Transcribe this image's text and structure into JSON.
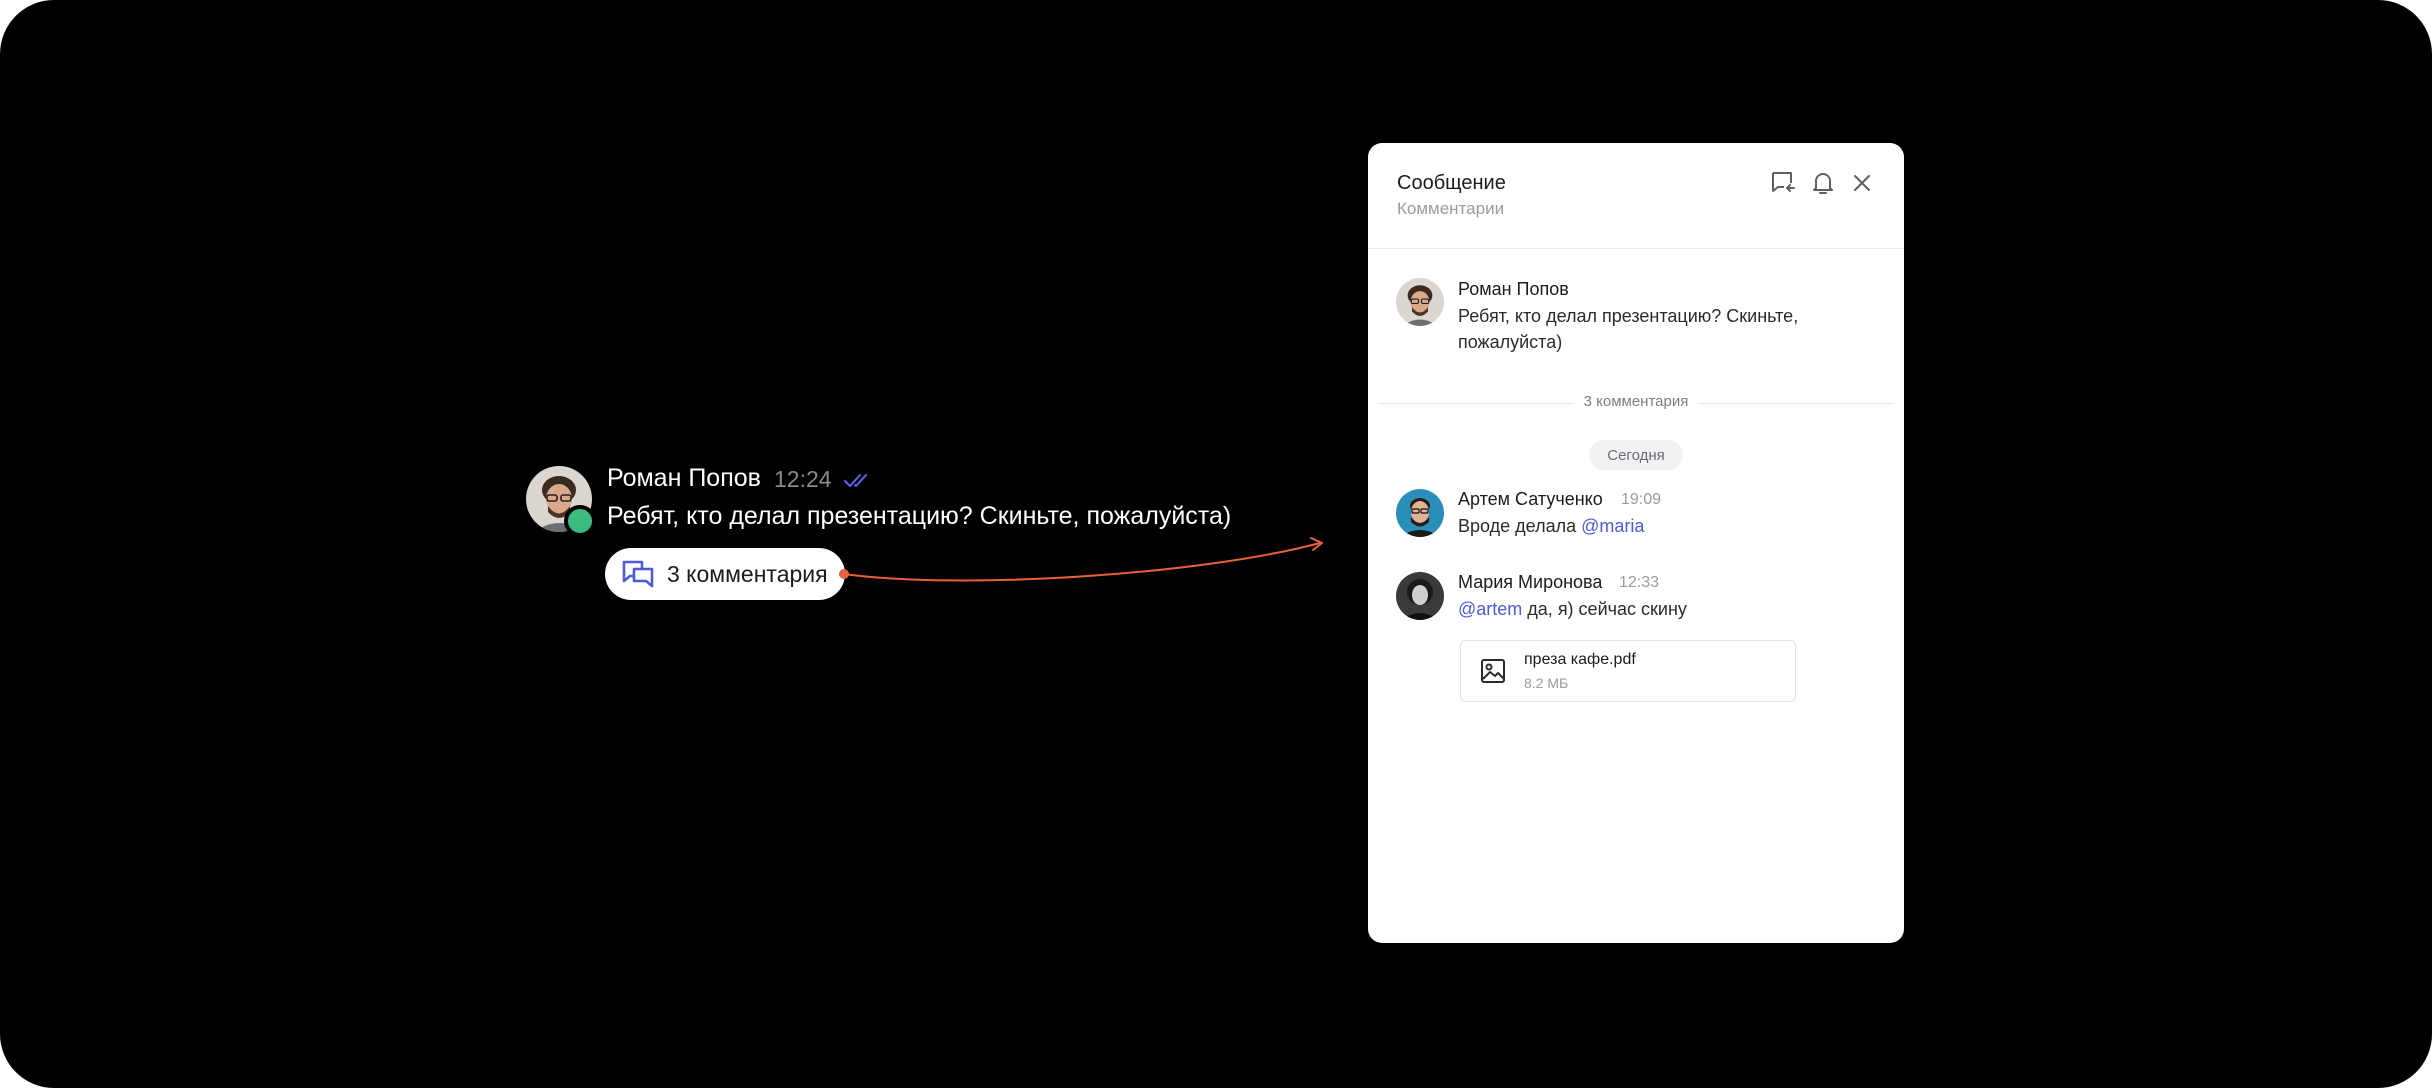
{
  "message": {
    "author": "Роман Попов",
    "time": "12:24",
    "text": "Ребят, кто делал презентацию? Скиньте, пожалуйста)",
    "comments_label": "3 комментария",
    "status": "online",
    "read_icon": "double-check-icon"
  },
  "panel": {
    "title": "Сообщение",
    "subtitle": "Комментарии",
    "header_icons": [
      "reply-icon",
      "bell-icon",
      "close-icon"
    ],
    "root": {
      "author": "Роман Попов",
      "text": "Ребят, кто делал презентацию? Скиньте, пожалуйста)"
    },
    "comments_count_label": "3 комментария",
    "day_label": "Сегодня",
    "comments": [
      {
        "author": "Артем Сатученко",
        "time": "19:09",
        "text": "Вроде делала ",
        "mention": "@maria"
      },
      {
        "author": "Мария Миронова",
        "time": "12:33",
        "mention": "@artem",
        "text": " да, я) сейчас скину",
        "file": {
          "name": "преза кафе.pdf",
          "size": "8.2 МБ",
          "icon": "image-icon"
        }
      }
    ]
  },
  "colors": {
    "background": "#000000",
    "accent": "#4f5bd5",
    "online": "#3cbb80",
    "connector": "#e8613c"
  }
}
